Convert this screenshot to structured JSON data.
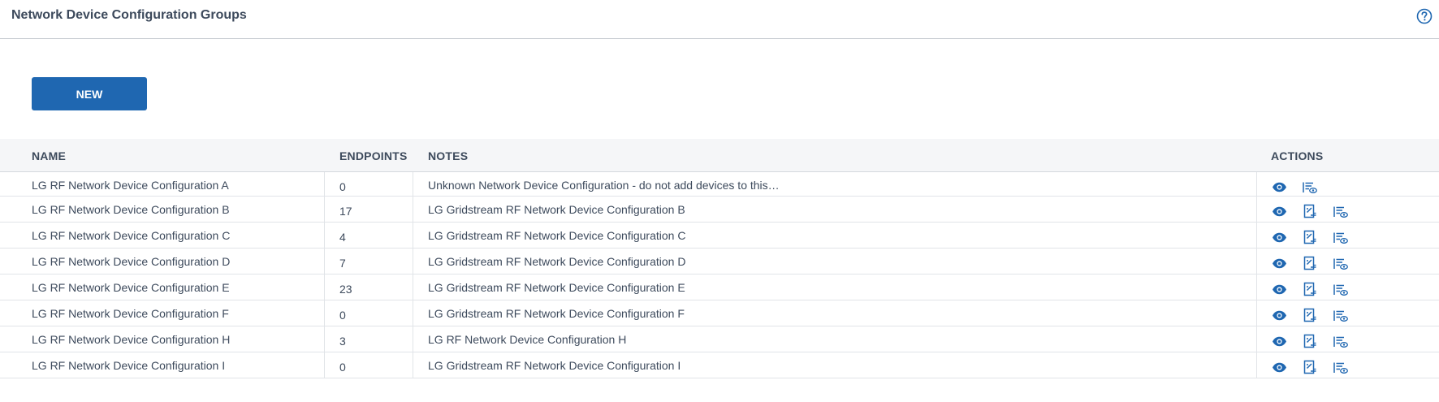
{
  "header": {
    "title": "Network Device Configuration Groups",
    "help_icon": "question-circle-icon"
  },
  "toolbar": {
    "new_label": "NEW"
  },
  "colors": {
    "accent": "#1f67b1",
    "text": "#3d4a5c",
    "header_bg": "#f5f6f8"
  },
  "table": {
    "columns": {
      "name": "NAME",
      "endpoints": "ENDPOINTS",
      "notes": "NOTES",
      "actions": "ACTIONS"
    },
    "rows": [
      {
        "name": "LG RF Network Device Configuration A",
        "endpoints": "0",
        "notes": "Unknown Network Device Configuration - do not add devices to this…",
        "actions": [
          "view-icon",
          "details-icon"
        ]
      },
      {
        "name": "LG RF Network Device Configuration B",
        "endpoints": "17",
        "notes": "LG Gridstream RF Network Device Configuration B",
        "actions": [
          "view-icon",
          "edit-icon",
          "details-icon"
        ]
      },
      {
        "name": "LG RF Network Device Configuration C",
        "endpoints": "4",
        "notes": "LG Gridstream RF Network Device Configuration C",
        "actions": [
          "view-icon",
          "edit-icon",
          "details-icon"
        ]
      },
      {
        "name": "LG RF Network Device Configuration D",
        "endpoints": "7",
        "notes": "LG Gridstream RF Network Device Configuration D",
        "actions": [
          "view-icon",
          "edit-icon",
          "details-icon"
        ]
      },
      {
        "name": "LG RF Network Device Configuration E",
        "endpoints": "23",
        "notes": "LG Gridstream RF Network Device Configuration E",
        "actions": [
          "view-icon",
          "edit-icon",
          "details-icon"
        ]
      },
      {
        "name": "LG RF Network Device Configuration F",
        "endpoints": "0",
        "notes": "LG Gridstream RF Network Device Configuration F",
        "actions": [
          "view-icon",
          "edit-icon",
          "details-icon"
        ]
      },
      {
        "name": "LG RF Network Device Configuration H",
        "endpoints": "3",
        "notes": "LG RF Network Device Configuration H",
        "actions": [
          "view-icon",
          "edit-icon",
          "details-icon"
        ]
      },
      {
        "name": "LG RF Network Device Configuration I",
        "endpoints": "0",
        "notes": "LG Gridstream RF Network Device Configuration I",
        "actions": [
          "view-icon",
          "edit-icon",
          "details-icon"
        ]
      }
    ]
  }
}
